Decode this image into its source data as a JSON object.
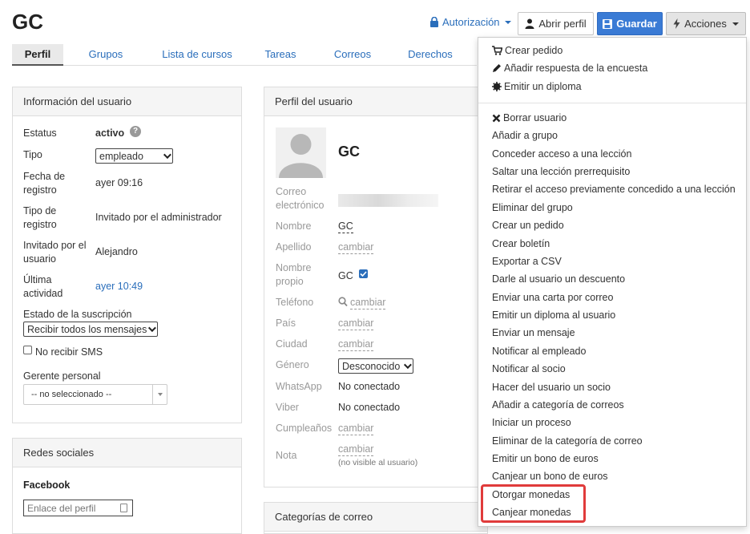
{
  "header": {
    "title": "GC",
    "authorization_label": "Autorización",
    "open_profile_label": "Abrir perfil",
    "save_label": "Guardar",
    "actions_label": "Acciones"
  },
  "tabs": [
    "Perfil",
    "Grupos",
    "Lista de cursos",
    "Tareas",
    "Correos",
    "Derechos"
  ],
  "user_info": {
    "title": "Información del usuario",
    "status_label": "Estatus",
    "status_value": "activo",
    "type_label": "Tipo",
    "type_value": "empleado",
    "reg_date_label": "Fecha de registro",
    "reg_date_value": "ayer 09:16",
    "reg_type_label": "Tipo de registro",
    "reg_type_value": "Invitado por el administrador",
    "invited_by_label": "Invitado por el usuario",
    "invited_by_value": "Alejandro",
    "last_activity_label": "Última actividad",
    "last_activity_value": "ayer 10:49",
    "subscription_label": "Estado de la suscripción",
    "subscription_value": "Recibir todos los mensajes",
    "no_sms_label": "No recibir SMS",
    "manager_label": "Gerente personal",
    "manager_value": "-- no seleccionado --"
  },
  "social": {
    "title": "Redes sociales",
    "facebook_label": "Facebook",
    "facebook_placeholder": "Enlace del perfil"
  },
  "profile": {
    "title": "Perfil del usuario",
    "name_heading": "GC",
    "email_label": "Correo electrónico",
    "first_name_label": "Nombre",
    "first_name_value": "GC",
    "last_name_label": "Apellido",
    "change": "cambiar",
    "own_name_label": "Nombre propio",
    "own_name_value": "GC",
    "phone_label": "Teléfono",
    "country_label": "País",
    "city_label": "Ciudad",
    "gender_label": "Género",
    "gender_value": "Desconocido",
    "whatsapp_label": "WhatsApp",
    "whatsapp_value": "No conectado",
    "viber_label": "Viber",
    "viber_value": "No conectado",
    "birthday_label": "Cumpleaños",
    "note_label": "Nota",
    "note_hint": "(no visible al usuario)"
  },
  "mail_categories": {
    "title": "Categorías de correo"
  },
  "actions_menu": {
    "top": [
      "Crear pedido",
      "Añadir respuesta de la encuesta",
      "Emitir un diploma"
    ],
    "items": [
      "Borrar usuario",
      "Añadir a grupo",
      "Conceder acceso a una lección",
      "Saltar una lección prerrequisito",
      "Retirar el acceso previamente concedido a una lección",
      "Eliminar del grupo",
      "Crear un pedido",
      "Crear boletín",
      "Exportar a CSV",
      "Darle al usuario un descuento",
      "Enviar una carta por correo",
      "Emitir un diploma al usuario",
      "Enviar un mensaje",
      "Notificar al empleado",
      "Notificar al socio",
      "Hacer del usuario un socio",
      "Añadir a categoría de correos",
      "Iniciar un proceso",
      "Eliminar de la categoría de correo",
      "Emitir un bono de euros",
      "Canjear un bono de euros",
      "Otorgar monedas",
      "Canjear monedas"
    ]
  },
  "colors": {
    "accent": "#2a6ebb",
    "save_button": "#3a7bd5",
    "highlight": "#e03b3b"
  }
}
